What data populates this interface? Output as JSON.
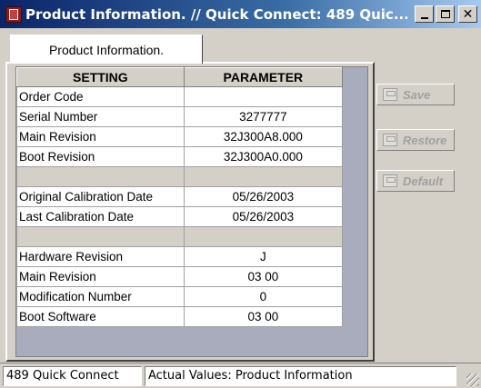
{
  "window": {
    "title": "Product Information. // Quick Connect: 489 Quic..."
  },
  "tab": {
    "label": "Product Information."
  },
  "grid": {
    "headers": [
      "SETTING",
      "PARAMETER"
    ],
    "rows": [
      {
        "setting": "Order Code",
        "value": ""
      },
      {
        "setting": "Serial Number",
        "value": "3277777"
      },
      {
        "setting": "Main Revision",
        "value": "32J300A8.000"
      },
      {
        "setting": "Boot Revision",
        "value": "32J300A0.000"
      },
      {
        "setting": "",
        "value": ""
      },
      {
        "setting": "Original Calibration Date",
        "value": "05/26/2003"
      },
      {
        "setting": "Last Calibration Date",
        "value": "05/26/2003"
      },
      {
        "setting": "",
        "value": ""
      },
      {
        "setting": "Hardware Revision",
        "value": "J"
      },
      {
        "setting": "Main Revision",
        "value": "03 00"
      },
      {
        "setting": "Modification Number",
        "value": "0"
      },
      {
        "setting": "Boot Software",
        "value": "03 00"
      }
    ]
  },
  "buttons": {
    "save": "Save",
    "restore": "Restore",
    "default": "Default"
  },
  "statusbar": {
    "left": "489 Quick Connect",
    "right": "Actual Values: Product Information"
  },
  "colors": {
    "title_bar_start": "#0a246a",
    "title_bar_end": "#a6caf0",
    "face": "#d4d0c8",
    "grid_background": "#a8acbc",
    "disabled_text": "#a0a0a0"
  }
}
